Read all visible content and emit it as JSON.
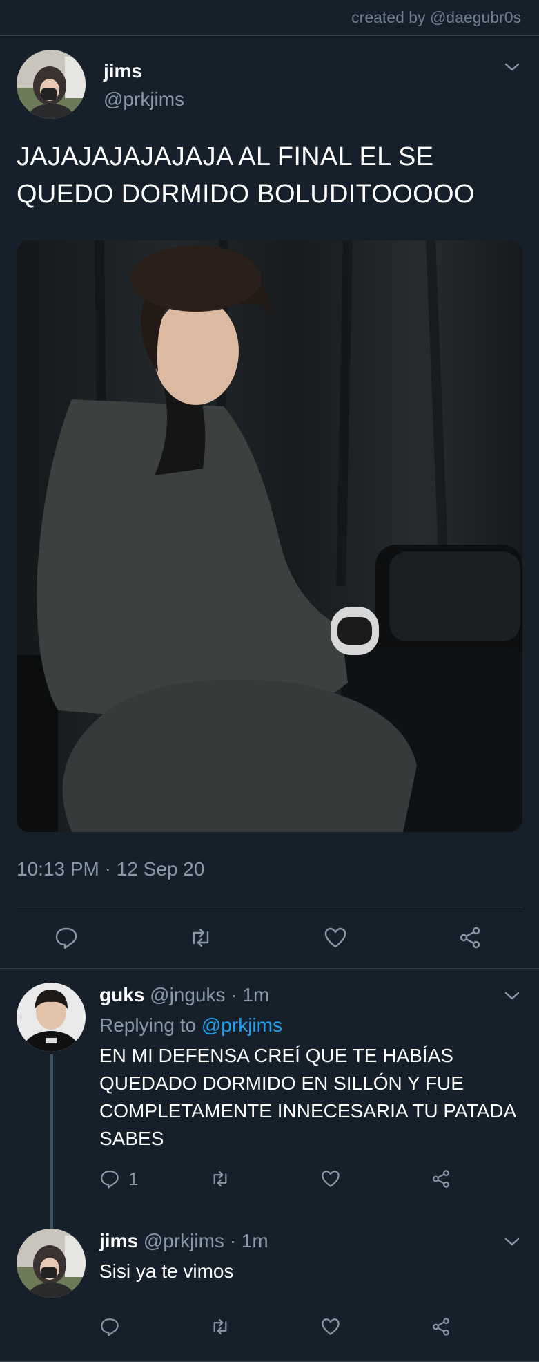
{
  "credit": "created by @daegubr0s",
  "tweet": {
    "author_name": "jims",
    "author_handle": "@prkjims",
    "text": "JAJAJAJAJAJAJA AL FINAL EL SE QUEDO DORMIDO BOLUDITOOOOO",
    "timestamp": "10:13 PM · 12 Sep 20",
    "actions": [
      "reply",
      "retweet",
      "like",
      "share"
    ]
  },
  "replies": [
    {
      "name": "guks",
      "handle": "@jnguks",
      "time": "· 1m",
      "replying_prefix": "Replying to",
      "replying_to": "@prkjims",
      "text": "EN MI DEFENSA CREÍ QUE TE HABÍAS QUEDADO DORMIDO EN SILLÓN Y FUE COMPLETAMENTE INNECESARIA TU PATADA SABES",
      "reply_count": "1"
    },
    {
      "name": "jims",
      "handle": "@prkjims",
      "time": "· 1m",
      "text": "Sisi ya te vimos"
    }
  ],
  "icons": {
    "reply": "speech-bubble-icon",
    "retweet": "retweet-arrows-icon",
    "like": "heart-icon",
    "share": "share-nodes-icon",
    "caret": "chevron-down-icon"
  },
  "colors": {
    "background": "#15202b",
    "divider": "#38444d",
    "muted": "#8899a6",
    "link": "#1da1f2"
  }
}
